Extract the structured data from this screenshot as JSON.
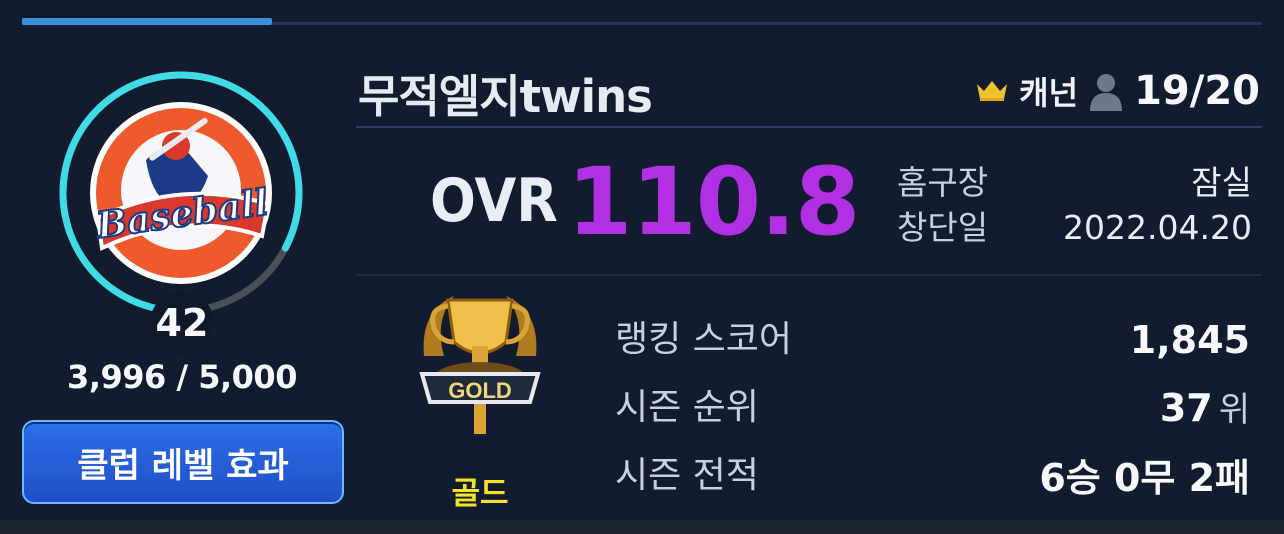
{
  "tabs": {
    "active_indicator_color": "#3b91d6",
    "line_color": "#223457"
  },
  "club": {
    "level": "42",
    "exp_current": "3,996",
    "exp_max": "5,000",
    "exp_text": "3,996 / 5,000",
    "exp_fraction": 0.7992,
    "effect_button": "클럽 레벨 효과",
    "logo": {
      "text": "Baseball",
      "icon": "baseball-batter-logo"
    }
  },
  "team": {
    "name": "무적엘지twins",
    "rank_icon": "crown-icon",
    "rank": "캐넌",
    "member_icon": "person-icon",
    "members": "19/20"
  },
  "ovr": {
    "label": "OVR",
    "value": "110.8",
    "color": "#b130e4"
  },
  "info": {
    "home_label": "홈구장",
    "home_value": "잠실",
    "founded_label": "창단일",
    "founded_value": "2022.04.20"
  },
  "tier": {
    "name": "골드",
    "emblem_text": "GOLD",
    "emblem_icon": "gold-trophy-icon",
    "color": "#f3e32b"
  },
  "stats": {
    "ranking_score_label": "랭킹 스코어",
    "ranking_score_value": "1,845",
    "season_rank_label": "시즌 순위",
    "season_rank_value": "37",
    "season_rank_unit": "위",
    "season_record_label": "시즌 전적",
    "season_record_value": "6승 0무 2패"
  }
}
